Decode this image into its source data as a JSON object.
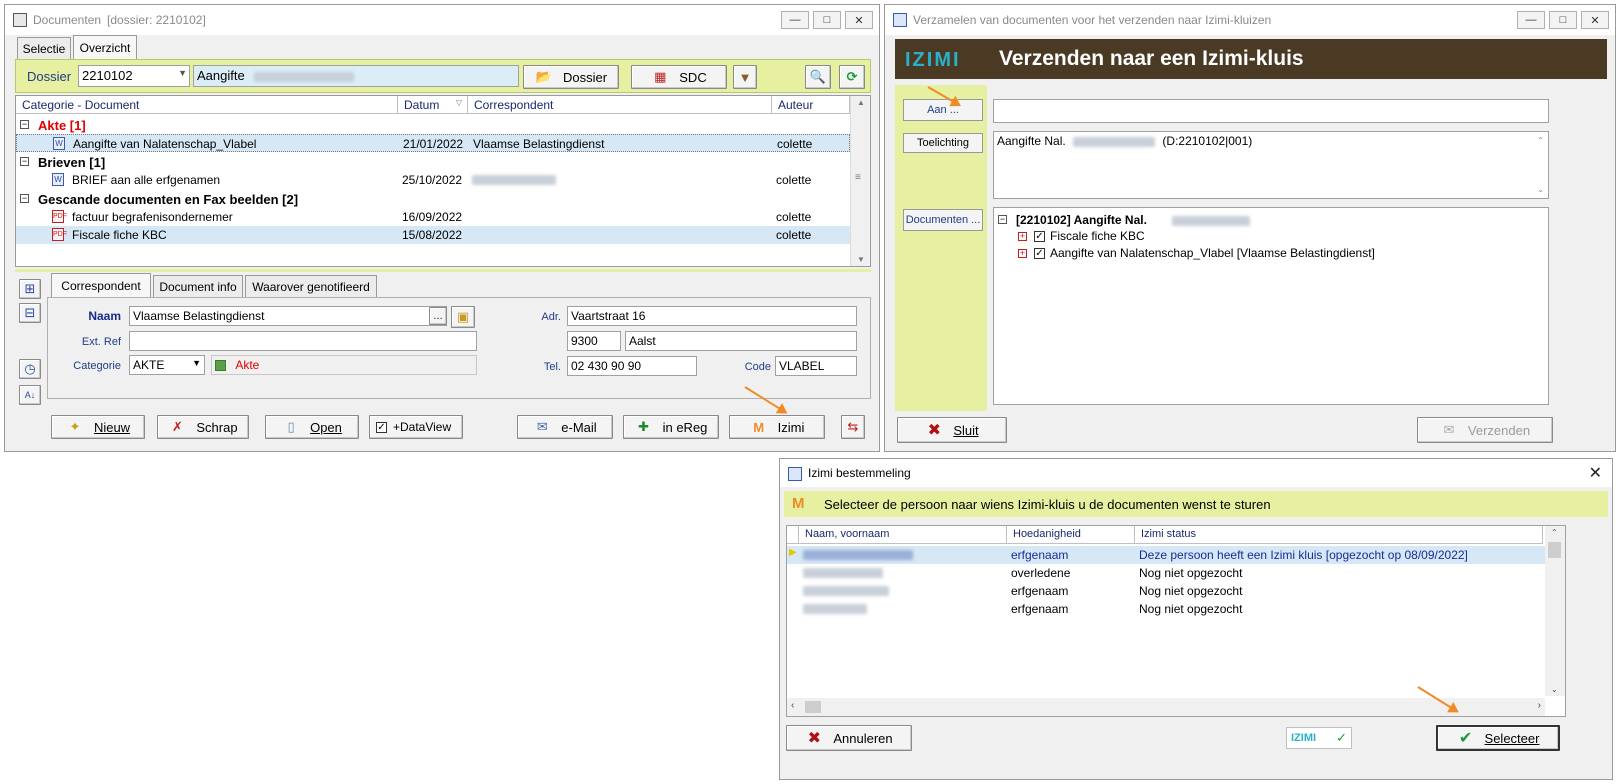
{
  "win1": {
    "title": "Documenten",
    "title_suffix": "[dossier: 2210102]",
    "tabs": [
      "Selectie",
      "Overzicht"
    ],
    "dossier_label": "Dossier",
    "dossier_value": "2210102",
    "dossier_desc": "Aangifte",
    "btn_dossier": "Dossier",
    "btn_sdc": "SDC",
    "columns": [
      "Categorie - Document",
      "Datum",
      "Correspondent",
      "Auteur"
    ],
    "groups": [
      {
        "label": "Akte [1]",
        "docs": [
          {
            "name": "Aangifte van Nalatenschap_Vlabel",
            "date": "21/01/2022",
            "corr": "Vlaamse Belastingdienst",
            "author": "colette"
          }
        ]
      },
      {
        "label": "Brieven [1]",
        "docs": [
          {
            "name": "BRIEF aan alle erfgenamen",
            "date": "25/10/2022",
            "corr": "",
            "author": "colette"
          }
        ]
      },
      {
        "label": "Gescande documenten en Fax beelden [2]",
        "docs": [
          {
            "name": "factuur begrafenisondernemer",
            "date": "16/09/2022",
            "corr": "",
            "author": "colette"
          },
          {
            "name": "Fiscale fiche KBC",
            "date": "15/08/2022",
            "corr": "",
            "author": "colette"
          }
        ]
      }
    ],
    "detail_tabs": [
      "Correspondent",
      "Document info",
      "Waarover genotifieerd"
    ],
    "naam_label": "Naam",
    "naam_value": "Vlaamse Belastingdienst",
    "extref_label": "Ext. Ref",
    "categorie_label": "Categorie",
    "categorie_value": "AKTE",
    "categorie_desc": "Akte",
    "adr_label": "Adr.",
    "adr_value": "Vaartstraat 16",
    "postcode": "9300",
    "city": "Aalst",
    "tel_label": "Tel.",
    "tel_value": "02 430 90 90",
    "code_label": "Code",
    "code_value": "VLABEL",
    "btn_nieuw": "Nieuw",
    "btn_schrap": "Schrap",
    "btn_open": "Open",
    "dataview_label": "+DataView",
    "btn_email": "e-Mail",
    "btn_ereg": "in eReg",
    "btn_izimi": "Izimi"
  },
  "win2": {
    "title": "Verzamelen van documenten voor het verzenden naar Izimi-kluizen",
    "logo": "IZIMI",
    "header": "Verzenden naar een Izimi-kluis",
    "btn_aan": "Aan ...",
    "toelichting_label": "Toelichting",
    "toelichting_prefix": "Aangifte Nal.",
    "toelichting_suffix": "(D:2210102|001)",
    "btn_documenten": "Documenten ...",
    "tree_root": "[2210102] Aangifte Nal.",
    "tree_items": [
      "Fiscale fiche KBC",
      "Aangifte van Nalatenschap_Vlabel [Vlaamse Belastingdienst]"
    ],
    "btn_sluit": "Sluit",
    "btn_verzenden": "Verzenden"
  },
  "win3": {
    "title": "Izimi bestemmeling",
    "instruction": "Selecteer de persoon naar wiens Izimi-kluis u de documenten wenst te sturen",
    "columns": [
      "Naam, voornaam",
      "Hoedanigheid",
      "Izimi status"
    ],
    "rows": [
      {
        "role": "erfgenaam",
        "status": "Deze persoon heeft een Izimi kluis [opgezocht op 08/09/2022]"
      },
      {
        "role": "overledene",
        "status": "Nog niet opgezocht"
      },
      {
        "role": "erfgenaam",
        "status": "Nog niet opgezocht"
      },
      {
        "role": "erfgenaam",
        "status": "Nog niet opgezocht"
      }
    ],
    "btn_annuleren": "Annuleren",
    "logo": "IZIMI",
    "btn_selecteer": "Selecteer"
  },
  "colors": {
    "accent_bar": "#e6f0a0",
    "selected_row": "#d6e8f5",
    "izimi_header": "#4a3a24",
    "arrow": "#f08a24",
    "group_red": "#e00000"
  }
}
